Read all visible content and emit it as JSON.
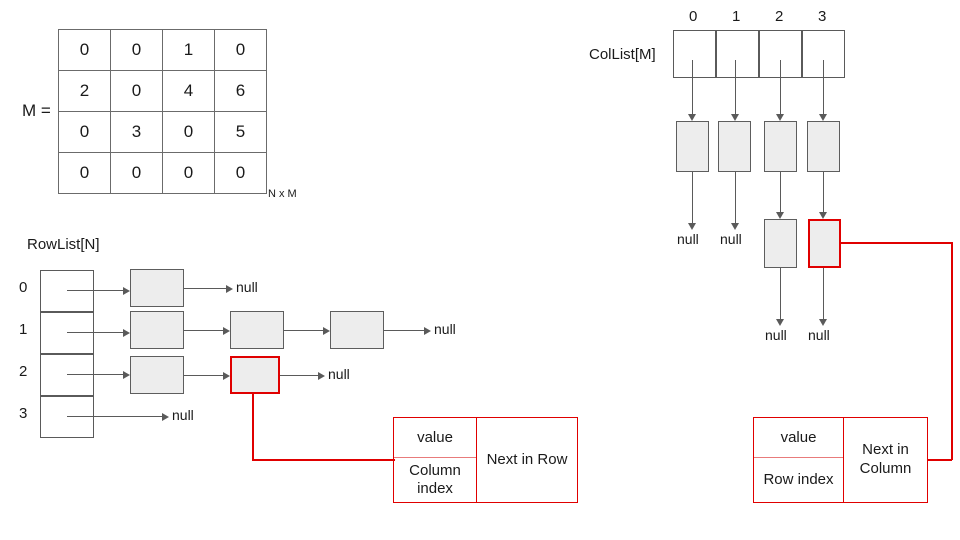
{
  "matrix": {
    "label": "M =",
    "dims_label": "N x M",
    "rows": [
      [
        "0",
        "0",
        "1",
        "0"
      ],
      [
        "2",
        "0",
        "4",
        "6"
      ],
      [
        "0",
        "3",
        "0",
        "5"
      ],
      [
        "0",
        "0",
        "0",
        "0"
      ]
    ]
  },
  "rowlist": {
    "title": "RowList[N]",
    "indices": [
      "0",
      "1",
      "2",
      "3"
    ],
    "null_label": "null",
    "rows": [
      {
        "index": "0",
        "node_count": 1,
        "terminates_null": true
      },
      {
        "index": "1",
        "node_count": 3,
        "terminates_null": true
      },
      {
        "index": "2",
        "node_count": 2,
        "terminates_null": true
      },
      {
        "index": "3",
        "node_count": 0,
        "terminates_null": true
      }
    ],
    "highlighted_node": "row-2-node-2"
  },
  "collist": {
    "title": "ColList[M]",
    "indices": [
      "0",
      "1",
      "2",
      "3"
    ],
    "null_label": "null",
    "columns": [
      {
        "index": "0",
        "node_count": 1,
        "terminates_null": true
      },
      {
        "index": "1",
        "node_count": 1,
        "terminates_null": true
      },
      {
        "index": "2",
        "node_count": 2,
        "terminates_null": true
      },
      {
        "index": "3",
        "node_count": 2,
        "terminates_null": true
      }
    ],
    "highlighted_node": "col-3-node-2"
  },
  "row_node_legend": {
    "value_label": "value",
    "index_label": "Column index",
    "next_label": "Next in Row"
  },
  "col_node_legend": {
    "value_label": "value",
    "index_label": "Row index",
    "next_label": "Next in Column"
  },
  "colors": {
    "highlight": "#e00000",
    "node_fill": "#ededed",
    "node_stroke": "#5d5d5d",
    "line": "#5a5a5a"
  }
}
